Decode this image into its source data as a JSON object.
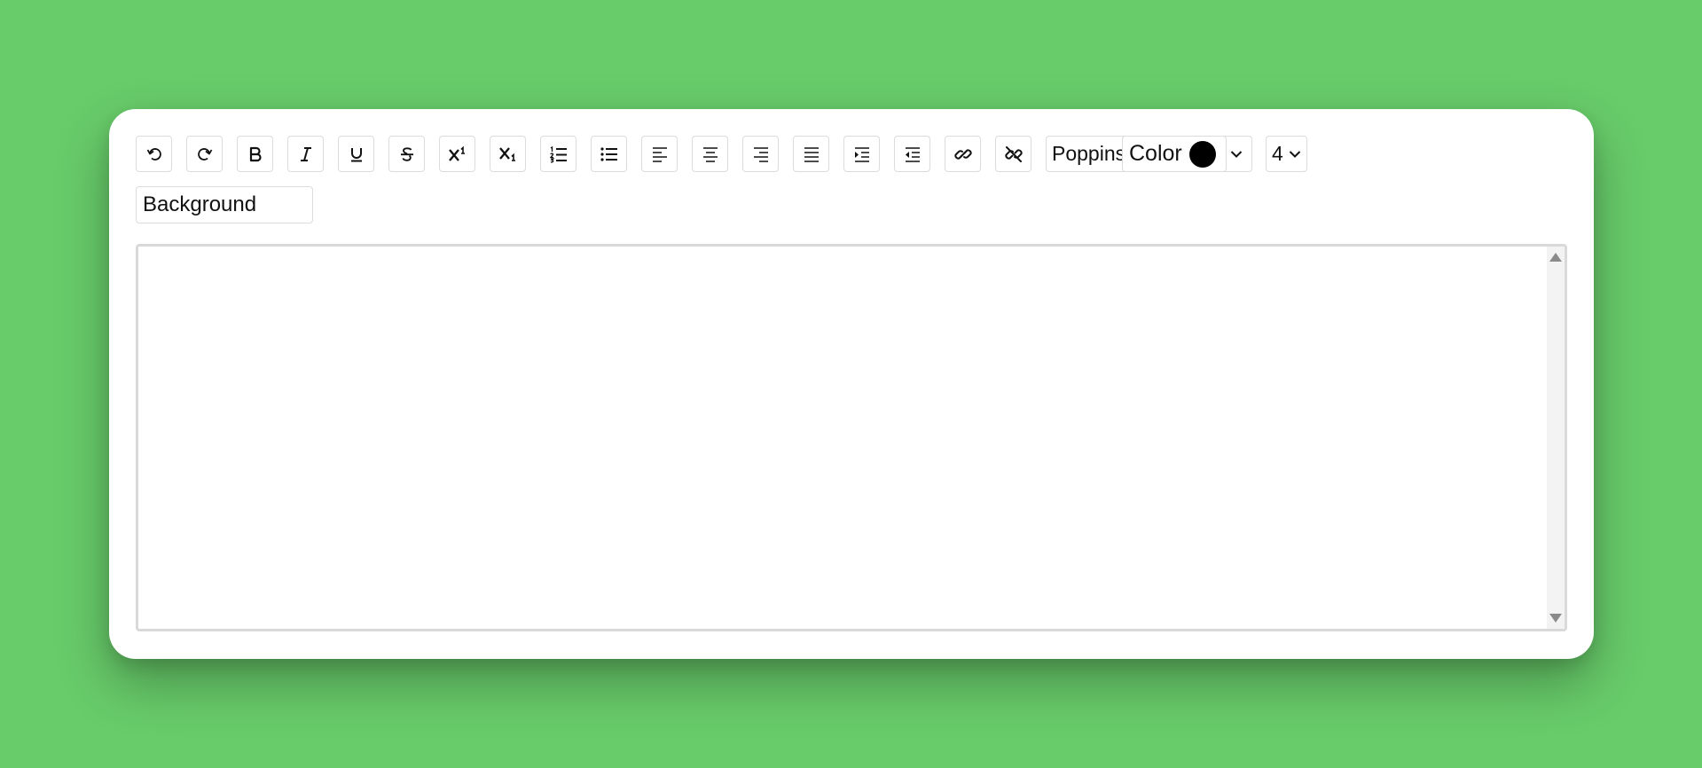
{
  "colors": {
    "page_background": "#68cc6a",
    "card_background": "#ffffff",
    "button_border": "#dcdcdc",
    "text_color_swatch": "#000000"
  },
  "toolbar": {
    "buttons": [
      {
        "name": "undo-button",
        "icon": "undo-icon"
      },
      {
        "name": "redo-button",
        "icon": "redo-icon"
      },
      {
        "name": "bold-button",
        "icon": "bold-icon"
      },
      {
        "name": "italic-button",
        "icon": "italic-icon"
      },
      {
        "name": "underline-button",
        "icon": "underline-icon"
      },
      {
        "name": "strikethrough-button",
        "icon": "strikethrough-icon"
      },
      {
        "name": "superscript-button",
        "icon": "superscript-icon"
      },
      {
        "name": "subscript-button",
        "icon": "subscript-icon"
      },
      {
        "name": "ordered-list-button",
        "icon": "ordered-list-icon"
      },
      {
        "name": "unordered-list-button",
        "icon": "unordered-list-icon"
      },
      {
        "name": "align-left-button",
        "icon": "align-left-icon"
      },
      {
        "name": "align-center-button",
        "icon": "align-center-icon"
      },
      {
        "name": "align-right-button",
        "icon": "align-right-icon"
      },
      {
        "name": "align-justify-button",
        "icon": "align-justify-icon"
      },
      {
        "name": "indent-button",
        "icon": "indent-icon"
      },
      {
        "name": "outdent-button",
        "icon": "outdent-icon"
      },
      {
        "name": "link-button",
        "icon": "link-icon"
      },
      {
        "name": "unlink-button",
        "icon": "unlink-icon"
      }
    ],
    "font_select": {
      "value": "Poppins"
    },
    "font_size_select": {
      "value": "4"
    },
    "color_label": "Color",
    "background_label": "Background"
  },
  "editor": {
    "content": ""
  }
}
